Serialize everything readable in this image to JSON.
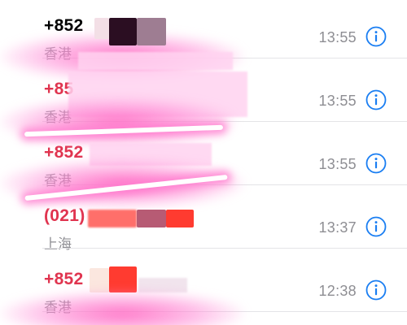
{
  "recents": [
    {
      "caller": "+852",
      "location": "香港",
      "time": "13:55",
      "missed": false
    },
    {
      "caller": "+85",
      "location": "香港",
      "time": "13:55",
      "missed": true
    },
    {
      "caller": "+852",
      "location": "香港",
      "time": "13:55",
      "missed": true
    },
    {
      "caller": "(021)",
      "location": "上海",
      "time": "13:37",
      "missed": true
    },
    {
      "caller": "+852",
      "location": "香港",
      "time": "12:38",
      "missed": true
    }
  ],
  "colors": {
    "normal_caller": "#000000",
    "missed_caller": "#e0344f",
    "secondary_text": "#8e8e93",
    "accent": "#1a7ef2",
    "redaction_pink": "#ff6ec7"
  },
  "icons": {
    "info": "info-circle-icon"
  }
}
